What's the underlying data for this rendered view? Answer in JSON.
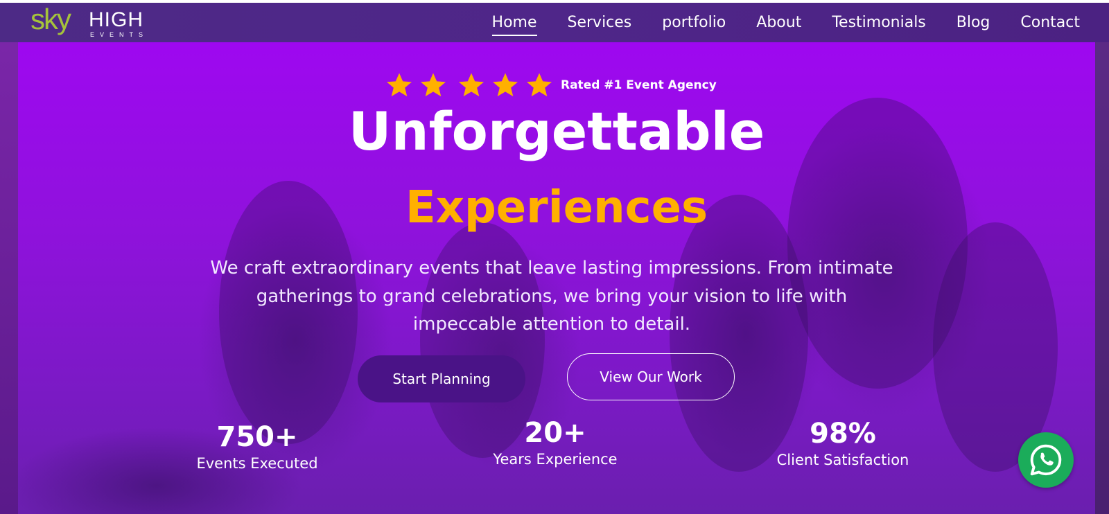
{
  "brand": {
    "logo_sky": "sky",
    "logo_high": "HIGH",
    "logo_events": "EVENTS"
  },
  "nav": {
    "items": [
      {
        "label": "Home",
        "active": true
      },
      {
        "label": "Services"
      },
      {
        "label": "portfolio"
      },
      {
        "label": "About"
      },
      {
        "label": "Testimonials"
      },
      {
        "label": "Blog"
      },
      {
        "label": "Contact"
      }
    ]
  },
  "hero": {
    "rating_text": "Rated #1 Event Agency",
    "star_count": 5,
    "headline_line1": "Unforgettable",
    "headline_line2": "Experiences",
    "description": "We craft extraordinary events that leave lasting impressions. From intimate gatherings to grand celebrations, we bring your vision to life with impeccable attention to detail.",
    "primary_button": "Start Planning",
    "secondary_button": "View Our Work"
  },
  "stats": [
    {
      "value": "750+",
      "label": "Events Executed"
    },
    {
      "value": "20+",
      "label": "Years Experience"
    },
    {
      "value": "98%",
      "label": "Client Satisfaction"
    }
  ],
  "colors": {
    "accent": "#ffb000",
    "hero_purple": "#9e08f0",
    "nav_bg": "#4f2689",
    "logo_green": "#a6c33b",
    "button_dark": "#4a1387",
    "whatsapp_green": "#1bac5a"
  },
  "icons": {
    "star": "star-icon",
    "whatsapp": "whatsapp-icon"
  }
}
